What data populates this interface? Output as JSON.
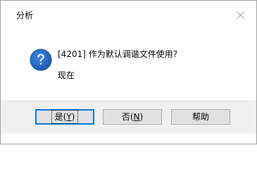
{
  "window": {
    "title": "分析"
  },
  "message": {
    "line1": "[4201] 作为默认调谐文件使用?",
    "line2": "现在",
    "icon": "question-icon"
  },
  "buttons": {
    "yes": {
      "prefix": "是(",
      "mnemonic": "Y",
      "suffix": ")"
    },
    "no": {
      "prefix": "否(",
      "mnemonic": "N",
      "suffix": ")"
    },
    "help": {
      "label": "帮助"
    }
  },
  "colors": {
    "accent": "#0078d7",
    "icon_blue": "#1c5fb8",
    "footer_bg": "#f0f0f0"
  }
}
